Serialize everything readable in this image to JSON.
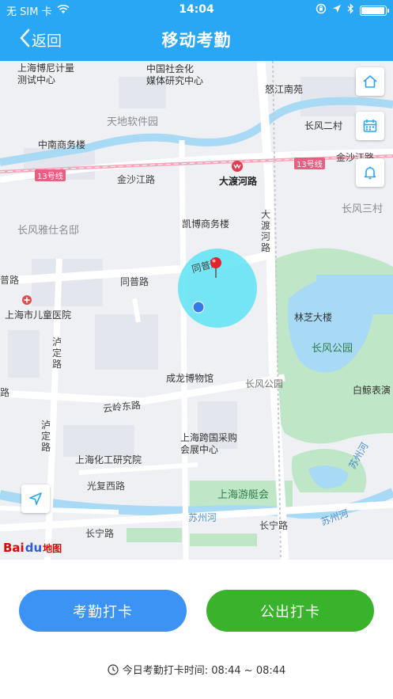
{
  "status_bar": {
    "carrier": "无 SIM 卡",
    "time": "14:04"
  },
  "nav": {
    "back_label": "返回",
    "title": "移动考勤"
  },
  "map": {
    "labels": {
      "boni": "上海博尼计量\n测试中心",
      "zhongguo": "中国社会化\n媒体研究中心",
      "nujiang": "怒江南苑",
      "tiandi": "天地软件园",
      "changfeng2": "长风二村",
      "zhongnan": "中南商务楼",
      "jinsha_r": "金沙江路",
      "line13_l": "13号线",
      "line13_r": "13号线",
      "jinsha_l": "金沙江路",
      "dadu_station": "大渡河路",
      "changfeng3": "长风三村",
      "kaibo": "凯博商务楼",
      "dadu_road": "大渡河路",
      "changfeng_yashi": "长风雅仕名邸",
      "tongpu_l": "普路",
      "tongpu": "同普路",
      "tongpu_circle": "同普路",
      "children_hosp": "上海市儿童医院",
      "linzhi": "林芝大楼",
      "luding": "泸定路",
      "changfeng_park": "长风公园",
      "bailing": "白鲸表演",
      "chenglong": "成龙博物馆",
      "changfeng_park_road": "长风公园",
      "yunling": "云岭东路",
      "lu_left": "路",
      "kuajing": "上海跨国采购\n会展中心",
      "luding2": "泸定路",
      "huagong": "上海化工研究院",
      "suzhou_v": "苏州河",
      "guangfu": "光复西路",
      "youting": "上海游艇会",
      "suzhou": "苏州河",
      "suzhou2": "苏州河",
      "changning_l": "长宁路",
      "changning_r": "长宁路"
    },
    "logo": {
      "bai": "Bai",
      "paw": "du",
      "ditu": "地图"
    }
  },
  "actions": {
    "checkin_label": "考勤打卡",
    "outside_label": "公出打卡"
  },
  "footer": {
    "text": "今日考勤打卡时间: 08:44 ~ 08:44"
  },
  "icons": [
    "back-chevron-icon",
    "wifi-icon",
    "lock-rotation-icon",
    "location-arrow-icon",
    "bluetooth-icon",
    "battery-icon",
    "home-icon",
    "calendar-icon",
    "bell-icon",
    "locate-me-icon",
    "map-pin-icon",
    "current-location-dot-icon",
    "clock-icon"
  ],
  "colors": {
    "header": "#2aa7f4",
    "checkin_button": "#3d93f4",
    "outside_button": "#39b32b",
    "accuracy_circle": "#5de3f3"
  }
}
